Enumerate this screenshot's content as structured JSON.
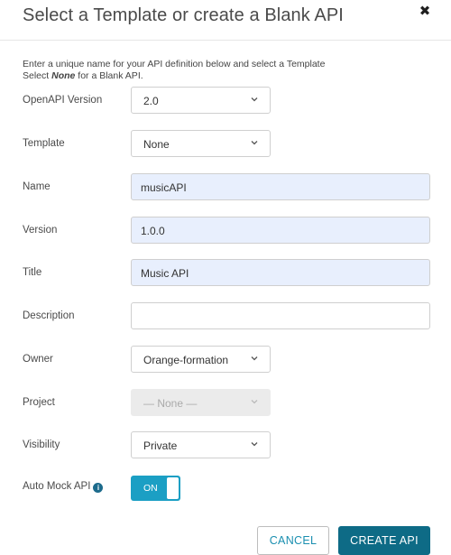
{
  "dialog": {
    "title": "Select a Template or create a Blank API",
    "close_symbol": "✖",
    "intro_line1": "Enter a unique name for your API definition below and select a Template",
    "intro_line2_prefix": "Select ",
    "intro_line2_em": "None",
    "intro_line2_suffix": " for a Blank API."
  },
  "fields": {
    "openapi_version": {
      "label": "OpenAPI Version",
      "value": "2.0"
    },
    "template": {
      "label": "Template",
      "value": "None"
    },
    "name": {
      "label": "Name",
      "value": "musicAPI"
    },
    "version": {
      "label": "Version",
      "value": "1.0.0"
    },
    "title": {
      "label": "Title",
      "value": "Music API"
    },
    "description": {
      "label": "Description",
      "value": ""
    },
    "owner": {
      "label": "Owner",
      "value": "Orange-formation"
    },
    "project": {
      "label": "Project",
      "value": "— None —",
      "disabled": true
    },
    "visibility": {
      "label": "Visibility",
      "value": "Private"
    },
    "auto_mock": {
      "label": "Auto Mock API",
      "info_icon": "i",
      "toggle_label": "ON",
      "state": "on"
    }
  },
  "actions": {
    "cancel_label": "CANCEL",
    "create_label": "CREATE API"
  },
  "icons": {
    "close": "close-icon",
    "chevron": "chevron-down-icon",
    "info": "info-icon"
  },
  "colors": {
    "primary": "#0e6b86",
    "toggle_on": "#1b9fc4",
    "cancel_text": "#1a8fb0",
    "autofill_bg": "#e8effd"
  }
}
